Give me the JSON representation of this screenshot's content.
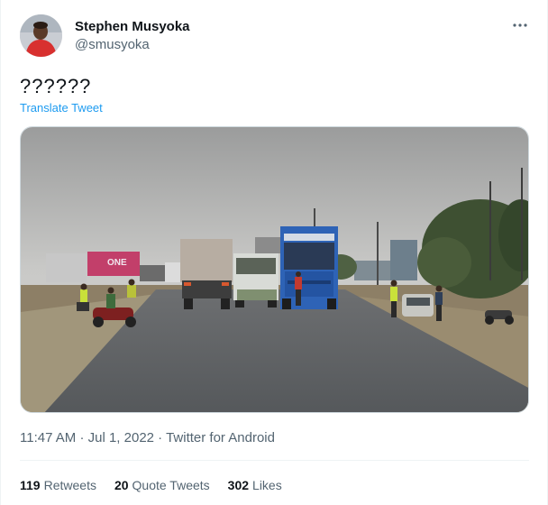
{
  "author": {
    "name": "Stephen Musyoka",
    "handle": "@smusyoka"
  },
  "tweet": {
    "text": "??????",
    "translate_label": "Translate Tweet",
    "time": "11:47 AM",
    "date": "Jul 1, 2022",
    "source": "Twitter for Android",
    "separator": "·"
  },
  "stats": {
    "retweets_count": "119",
    "retweets_label": "Retweets",
    "quotes_count": "20",
    "quotes_label": "Quote Tweets",
    "likes_count": "302",
    "likes_label": "Likes"
  },
  "truck_sign": "ONE",
  "icons": {
    "more": "more-horizontal-icon"
  },
  "colors": {
    "link": "#1d9bf0",
    "secondary_text": "#536471",
    "primary_text": "#0f1419",
    "border": "#eff3f4"
  }
}
